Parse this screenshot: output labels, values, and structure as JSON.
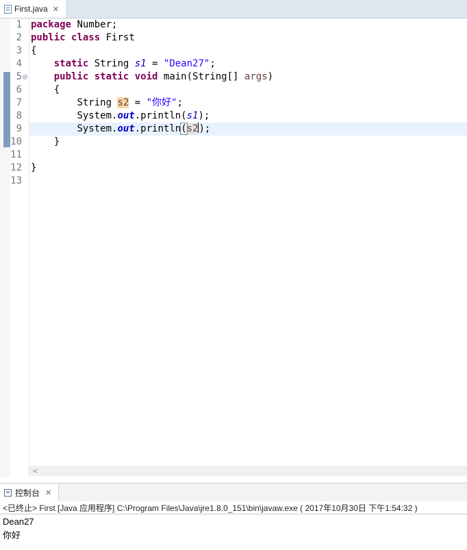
{
  "editor": {
    "tab_label": "First.java",
    "line_numbers": [
      "1",
      "2",
      "3",
      "4",
      "5",
      "6",
      "7",
      "8",
      "9",
      "10",
      "11",
      "12",
      "13"
    ],
    "code": {
      "l1_kw": "package",
      "l1_rest": " Number;",
      "l2_kw1": "public",
      "l2_kw2": "class",
      "l2_rest": " First",
      "l3": "{",
      "l4_kw": "static",
      "l4_type": " String ",
      "l4_var": "s1",
      "l4_eq": " = ",
      "l4_str": "\"Dean27\"",
      "l4_end": ";",
      "l5_kw1": "public",
      "l5_kw2": "static",
      "l5_kw3": "void",
      "l5_rest": " main(String[] ",
      "l5_param": "args",
      "l5_end": ")",
      "l6": "{",
      "l7_type": "String ",
      "l7_var": "s2",
      "l7_eq": " = ",
      "l7_str": "\"你好\"",
      "l7_end": ";",
      "l8_a": "System.",
      "l8_out": "out",
      "l8_b": ".println(",
      "l8_arg": "s1",
      "l8_end": ");",
      "l9_a": "System.",
      "l9_out": "out",
      "l9_b": ".println",
      "l9_paren": "(",
      "l9_arg": "s2",
      "l9_end": ");",
      "l10": "}",
      "l12": "}"
    }
  },
  "console": {
    "tab_label": "控制台",
    "status": "<已终止> First [Java 应用程序] C:\\Program Files\\Java\\jre1.8.0_151\\bin\\javaw.exe ( 2017年10月30日 下午1:54:32 )",
    "output": [
      "Dean27",
      "你好"
    ]
  },
  "colors": {
    "keyword": "#7f0055",
    "string": "#2a00ff",
    "field": "#0000c0",
    "local_variable": "#6a3e3e",
    "current_line": "#e8f2fe",
    "occurrence_highlight": "#f6d7a9"
  },
  "icons": [
    "java-file-icon",
    "close-icon",
    "fold-collapse-icon",
    "console-icon",
    "scroll-left-icon"
  ]
}
